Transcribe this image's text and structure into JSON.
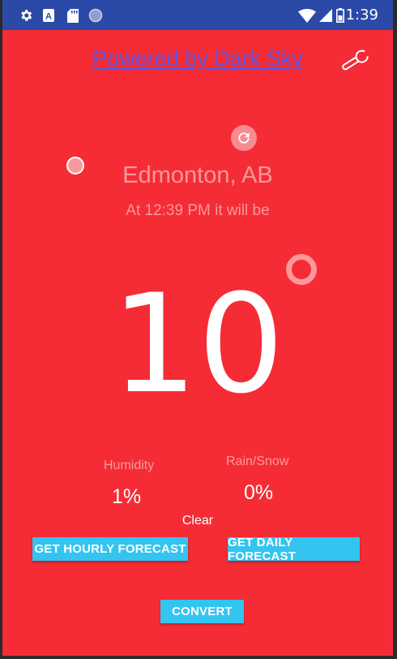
{
  "status_bar": {
    "time": "1:39",
    "icons": [
      "gear-icon",
      "a-badge-icon",
      "sd-card-icon",
      "circle-icon",
      "wifi-icon",
      "signal-icon",
      "battery-icon"
    ]
  },
  "header": {
    "powered_by_link": "Powered by Dark Sky",
    "settings_icon": "wrench-icon"
  },
  "location": {
    "city": "Edmonton, AB",
    "forecast_time": "At 12:39 PM it will be"
  },
  "weather": {
    "temperature": "10",
    "humidity_label": "Humidity",
    "humidity_value": "1%",
    "precip_label": "Rain/Snow",
    "precip_value": "0%",
    "summary": "Clear"
  },
  "buttons": {
    "hourly": "GET HOURLY FORECAST",
    "daily": "GET DAILY FORECAST",
    "convert": "CONVERT"
  },
  "colors": {
    "background": "#f52c36",
    "status_bar": "#2b4aa7",
    "button": "#33c4f0",
    "link": "#5b56e3",
    "muted_text": "#f8989b"
  }
}
